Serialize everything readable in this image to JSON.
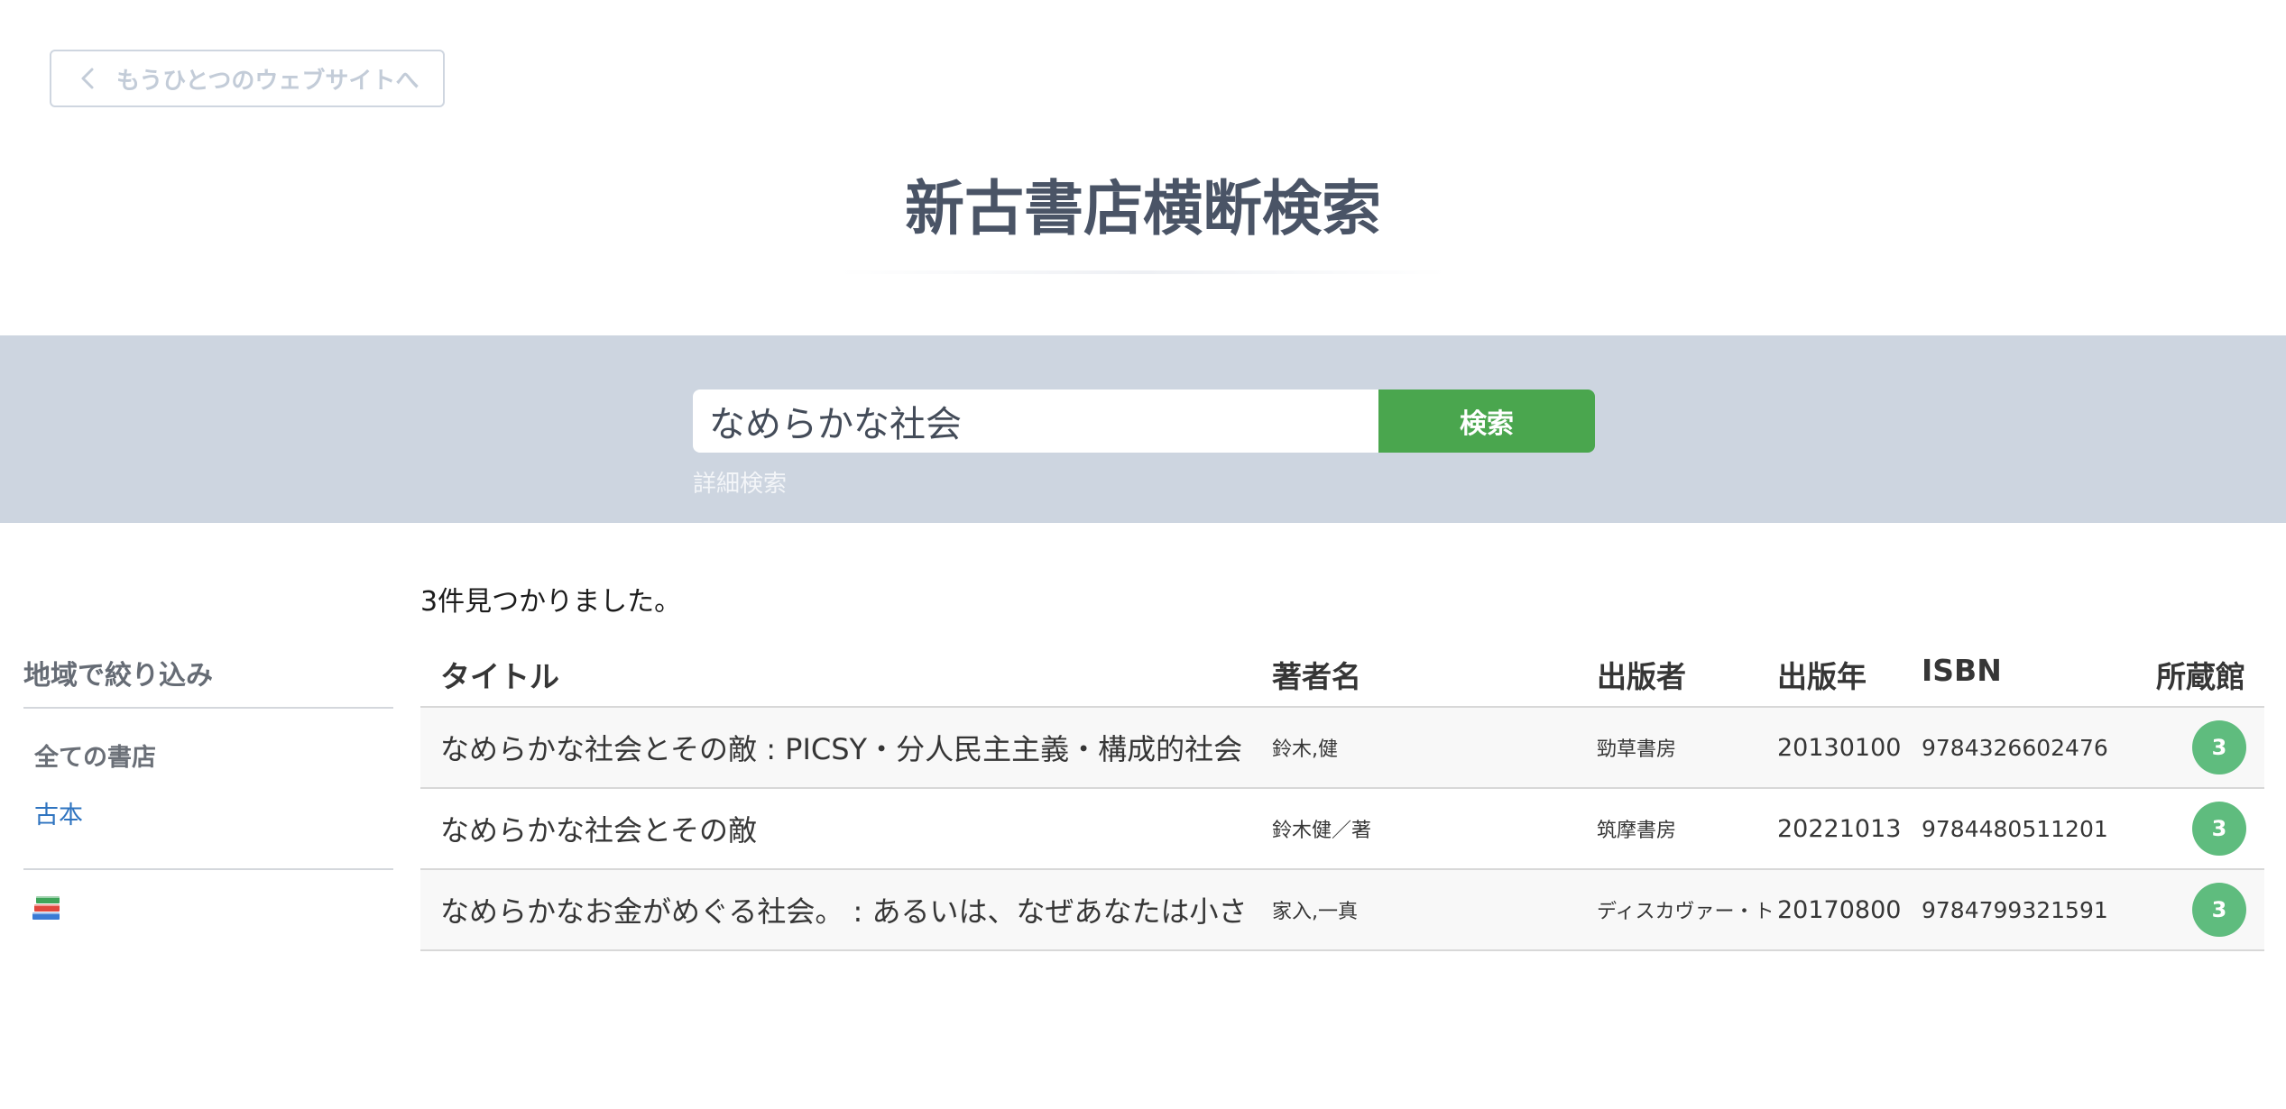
{
  "back_button": {
    "label": "もうひとつのウェブサイトへ"
  },
  "header": {
    "title": "新古書店横断検索"
  },
  "search": {
    "value": "なめらかな社会",
    "button_label": "検索",
    "advanced_link": "詳細検索"
  },
  "sidebar": {
    "heading": "地域で絞り込み",
    "items": [
      {
        "label": "全ての書店"
      },
      {
        "label": "古本"
      }
    ],
    "footer_icon": "books-emoji-icon"
  },
  "results": {
    "count_text": "3件見つかりました。",
    "columns": [
      "タイトル",
      "著者名",
      "出版者",
      "出版年",
      "ISBN",
      "所蔵館"
    ],
    "rows": [
      {
        "title": "なめらかな社会とその敵 : PICSY・分人民主主義・構成的社会",
        "author": "鈴木,健",
        "publisher": "勁草書房",
        "year": "20130100",
        "isbn": "9784326602476",
        "holdings": "3"
      },
      {
        "title": "なめらかな社会とその敵",
        "author": "鈴木健／著",
        "publisher": "筑摩書房",
        "year": "20221013",
        "isbn": "9784480511201",
        "holdings": "3"
      },
      {
        "title": "なめらかなお金がめぐる社会。 : あるいは、なぜあなたは小さ",
        "author": "家入,一真",
        "publisher": "ディスカヴァー・ト",
        "year": "20170800",
        "isbn": "9784799321591",
        "holdings": "3"
      }
    ]
  },
  "colors": {
    "search_band": "#cdd5e0",
    "search_button": "#4aa64e",
    "holdings_badge": "#5fbc7e",
    "link": "#2f74c0",
    "title_text": "#4a5466"
  }
}
